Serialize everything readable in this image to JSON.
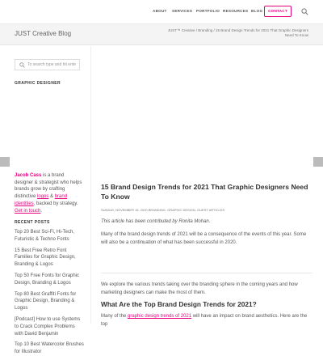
{
  "nav": {
    "items": [
      "ABOUT",
      "SERVICES",
      "PORTFOLIO",
      "RESOURCES",
      "BLOG"
    ],
    "contact_label": "CONTACT"
  },
  "titlebar": {
    "title": "JUST Creative Blog",
    "breadcrumbs": "JUST™ Creative / Branding / 15 Brand Design Trends for 2021 That Graphic Designers Need To Know"
  },
  "sidebar": {
    "search_placeholder": "To search type and hit ente",
    "graphic_designer_heading": "GRAPHIC DESIGNER",
    "bio_name": "Jacob Cass",
    "bio_text_1": " is a brand designer & strategist who helps brands grow by crafting distinctive ",
    "bio_link_logos": "logos",
    "bio_text_2": " & ",
    "bio_link_identities": "brand identities",
    "bio_text_3": ", backed by strategy. ",
    "bio_link_contact": "Get in touch",
    "bio_text_4": ".",
    "recent_heading": "RECENT POSTS",
    "recent_posts": [
      "Top 20 Best Sci-Fi, Hi-Tech, Futuristic & Techno Fonts",
      "15 Best Free Retro Font Families for Graphic Design, Branding & Logos",
      "Top 50 Free Fonts for Graphic Design, Branding & Logos",
      "Top 80 Best Graffiti Fonts for Graphic Design, Branding & Logos",
      "[Podcast] How to use Systems to Crack Complex Problems with David Benjamin",
      "Top 10 Best Watercolor Brushes for Illustrator"
    ]
  },
  "post": {
    "title": "15 Brand Design Trends for 2021 That Graphic Designers Need To Know",
    "meta": "SUNDAY, NOVEMBER 15, 2020     BRANDING, GRAPHIC DESIGN, GUEST ARTICLES",
    "contributed": "This article has been contributed by Ronita Mohan.",
    "para1": "Many of the brand design trends of 2021 will be a consequence of the events of this year. Some will also be a continuation of what has been successful in 2020.",
    "para2": "We explore the various trends taking over the branding sphere in the coming years and how marketing designers can make the most of them.",
    "h2": "What Are the Top Brand Design Trends for 2021?",
    "para3_a": "Many of the ",
    "para3_link": "graphic design trends of 2021",
    "para3_b": " will have an impact on brand aesthetics. Here are the top"
  },
  "colors": {
    "accent": "#e6007e",
    "titlebar_bg": "#f4f4f4"
  },
  "icons": {
    "search": "search-icon",
    "prev": "chevron-left-icon",
    "next": "chevron-right-icon"
  }
}
